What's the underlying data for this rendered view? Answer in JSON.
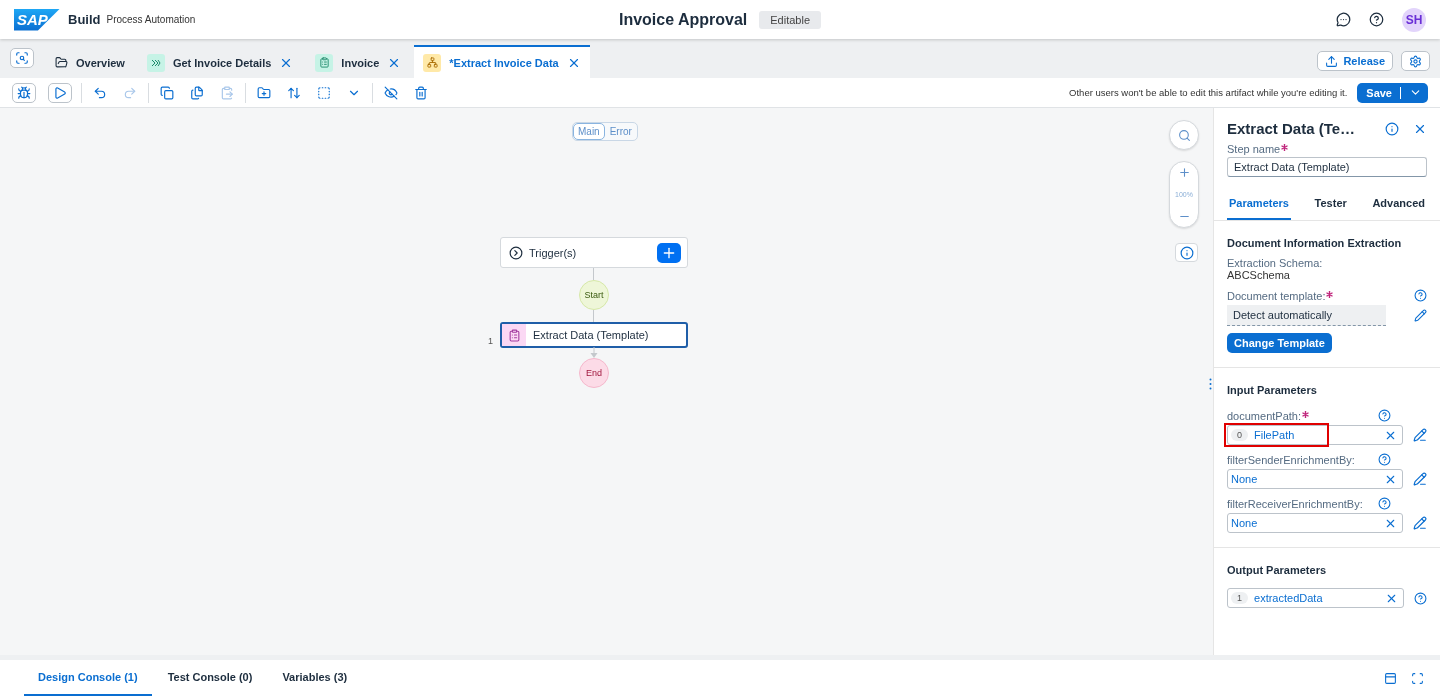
{
  "header": {
    "logo": "SAP",
    "product": "Build",
    "subtitle": "Process Automation",
    "title": "Invoice Approval",
    "status": "Editable",
    "avatar": "SH"
  },
  "tabs": [
    {
      "label": "Overview",
      "kind": "overview",
      "selected": false,
      "closable": false
    },
    {
      "label": "Get Invoice Details",
      "kind": "automation",
      "selected": false,
      "closable": true
    },
    {
      "label": "Invoice",
      "kind": "form",
      "selected": false,
      "closable": true
    },
    {
      "label": "*Extract Invoice Data",
      "kind": "process",
      "selected": true,
      "closable": true
    }
  ],
  "release": "Release",
  "toolbar": {
    "groups": [
      [
        {
          "kind": "debug",
          "disabled": false
        },
        {
          "kind": "run",
          "disabled": false
        }
      ],
      [
        {
          "kind": "undo",
          "disabled": false
        },
        {
          "kind": "redo",
          "disabled": true
        }
      ],
      [
        {
          "kind": "copy",
          "disabled": false
        },
        {
          "kind": "duplicate",
          "disabled": false
        },
        {
          "kind": "paste",
          "disabled": true
        }
      ],
      [
        {
          "kind": "add-folder",
          "disabled": false
        },
        {
          "kind": "sort",
          "disabled": false
        },
        {
          "kind": "select",
          "disabled": false
        },
        {
          "kind": "more",
          "disabled": false
        }
      ],
      [
        {
          "kind": "hide",
          "disabled": false
        },
        {
          "kind": "delete",
          "disabled": false
        }
      ]
    ],
    "notice": "Other users won't be able to edit this artifact while you're editing it.",
    "save": "Save"
  },
  "canvas": {
    "views": [
      {
        "label": "Main",
        "selected": true
      },
      {
        "label": "Error",
        "selected": false
      }
    ],
    "zoom": "100%",
    "trigger": "Trigger(s)",
    "start": "Start",
    "steps": [
      {
        "number": "1",
        "label": "Extract Data (Template)",
        "selected": true
      }
    ],
    "end": "End"
  },
  "panel": {
    "title": "Extract Data (Te…",
    "step_name_label": "Step name",
    "step_name": "Extract Data (Template)",
    "tabs": [
      {
        "label": "Parameters",
        "selected": true
      },
      {
        "label": "Tester",
        "selected": false
      },
      {
        "label": "Advanced",
        "selected": false
      }
    ],
    "section": "Document Information Extraction",
    "schema_label": "Extraction Schema:",
    "schema": "ABCSchema",
    "template_label": "Document template:",
    "template": "Detect automatically",
    "change_button": "Change Template",
    "inputs_title": "Input Parameters",
    "inputs": [
      {
        "label": "documentPath:",
        "required": true,
        "index": "0",
        "value": "FilePath",
        "highlighted": true
      },
      {
        "label": "filterSenderEnrichmentBy:",
        "required": false,
        "value": "None",
        "highlighted": false
      },
      {
        "label": "filterReceiverEnrichmentBy:",
        "required": false,
        "value": "None",
        "highlighted": false
      }
    ],
    "outputs_title": "Output Parameters",
    "outputs": [
      {
        "index": "1",
        "value": "extractedData"
      }
    ]
  },
  "console_tabs": [
    {
      "label": "Design Console (1)",
      "selected": true
    },
    {
      "label": "Test Console (0)",
      "selected": false
    },
    {
      "label": "Variables (3)",
      "selected": false
    }
  ]
}
